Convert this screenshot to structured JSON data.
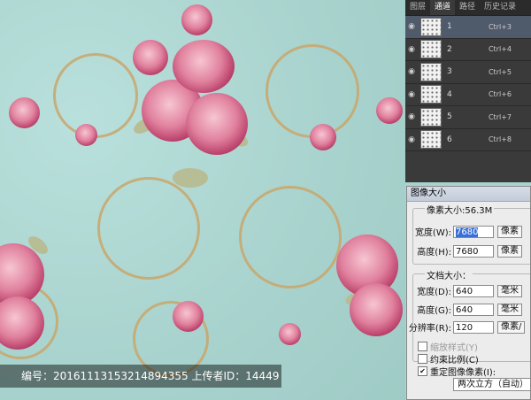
{
  "watermark": {
    "text": "编号：20161113153214894355 上传者ID：14449"
  },
  "panel": {
    "tabs": [
      "图层",
      "通道",
      "路径",
      "历史记录"
    ],
    "active_tab": "通道",
    "channels": [
      {
        "name": "1",
        "shortcut": "Ctrl+3"
      },
      {
        "name": "2",
        "shortcut": "Ctrl+4"
      },
      {
        "name": "3",
        "shortcut": "Ctrl+5"
      },
      {
        "name": "4",
        "shortcut": "Ctrl+6"
      },
      {
        "name": "5",
        "shortcut": "Ctrl+7"
      },
      {
        "name": "6",
        "shortcut": "Ctrl+8"
      }
    ]
  },
  "dialog": {
    "title": "图像大小",
    "pixel_dimensions": "像素大小:56.3M",
    "width_label": "宽度(W):",
    "width_value": "7680",
    "width_unit": "像素",
    "height_label": "高度(H):",
    "height_value": "7680",
    "height_unit": "像素",
    "doc_size_label": "文档大小：",
    "doc_width_label": "宽度(D):",
    "doc_width_value": "640",
    "doc_width_unit": "毫米",
    "doc_height_label": "高度(G):",
    "doc_height_value": "640",
    "doc_height_unit": "毫米",
    "resolution_label": "分辨率(R):",
    "resolution_value": "120",
    "resolution_unit": "像素/",
    "scale_styles": "缩放样式(Y)",
    "constrain": "约束比例(C)",
    "resample": "重定图像像素(I):",
    "resample_method": "两次立方（自动）"
  }
}
